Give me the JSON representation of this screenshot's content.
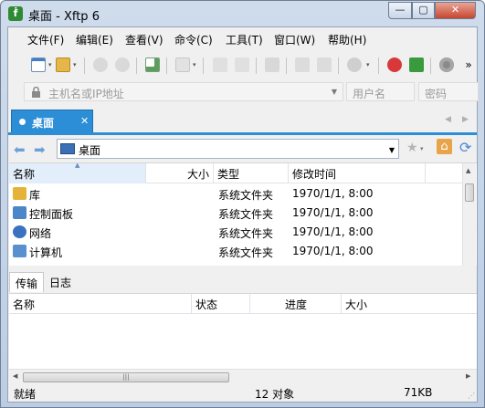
{
  "window": {
    "title": "桌面 - Xftp 6",
    "app_icon_glyph": "ḟ",
    "min_glyph": "—",
    "max_glyph": "▢",
    "close_glyph": "✕"
  },
  "menu": [
    "文件(F)",
    "编辑(E)",
    "查看(V)",
    "命令(C)",
    "工具(T)",
    "窗口(W)",
    "帮助(H)"
  ],
  "toolbar": {
    "icons": [
      "new-session-icon",
      "open-folder-icon",
      "disconnect-icon",
      "reconnect-icon",
      "session-properties-icon",
      "play-icon",
      "upload-icon",
      "download-icon",
      "sync-icon",
      "copy-icon",
      "paste-icon",
      "globe-icon",
      "xshell-icon",
      "xftp-icon",
      "settings-icon",
      "more-icon"
    ],
    "more_glyph": "»"
  },
  "address": {
    "host_placeholder": "主机名或IP地址",
    "user_placeholder": "用户名",
    "password_placeholder": "密码"
  },
  "tabs": {
    "active_label": "桌面",
    "close_glyph": "✕",
    "prev_glyph": "◀",
    "next_glyph": "▶"
  },
  "path": {
    "back_glyph": "⬅",
    "forward_glyph": "➡",
    "current": "桌面",
    "refresh_glyph": "⟳",
    "bookmark_glyph": "★",
    "home_glyph": "⌂"
  },
  "file_columns": [
    "名称",
    "大小",
    "类型",
    "修改时间"
  ],
  "files": [
    {
      "name": "库",
      "size": "",
      "type": "系统文件夹",
      "modified": "1970/1/1, 8:00",
      "icon": "library-icon",
      "color": "#e5b33a"
    },
    {
      "name": "控制面板",
      "size": "",
      "type": "系统文件夹",
      "modified": "1970/1/1, 8:00",
      "icon": "control-panel-icon",
      "color": "#4a86c8"
    },
    {
      "name": "网络",
      "size": "",
      "type": "系统文件夹",
      "modified": "1970/1/1, 8:00",
      "icon": "network-icon",
      "color": "#3a72c0"
    },
    {
      "name": "计算机",
      "size": "",
      "type": "系统文件夹",
      "modified": "1970/1/1, 8:00",
      "icon": "computer-icon",
      "color": "#5a8fd0"
    }
  ],
  "lower_tabs": [
    "传输",
    "日志"
  ],
  "transfer_columns": [
    "名称",
    "状态",
    "进度",
    "大小"
  ],
  "status": {
    "state": "就绪",
    "count": "12 对象",
    "size": "71KB"
  }
}
